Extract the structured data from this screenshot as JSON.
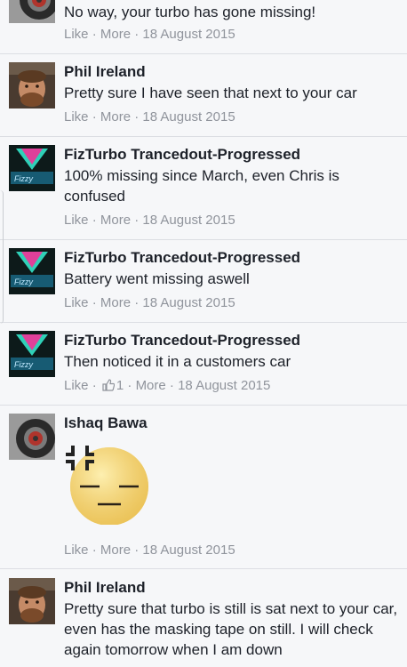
{
  "comments": [
    {
      "name": "",
      "text": "No way, your turbo has gone missing!",
      "like": "Like",
      "more": "More",
      "date": "18 August 2015"
    },
    {
      "name": "Phil Ireland",
      "text": "Pretty sure I have seen that next to your car",
      "like": "Like",
      "more": "More",
      "date": "18 August 2015"
    },
    {
      "name": "FizTurbo Trancedout-Progressed",
      "text": "100% missing since March, even Chris is confused",
      "like": "Like",
      "more": "More",
      "date": "18 August 2015"
    },
    {
      "name": "FizTurbo Trancedout-Progressed",
      "text": "Battery went missing aswell",
      "like": "Like",
      "more": "More",
      "date": "18 August 2015"
    },
    {
      "name": "FizTurbo Trancedout-Progressed",
      "text": "Then noticed it in a customers car",
      "like": "Like",
      "like_count": "1",
      "more": "More",
      "date": "18 August 2015"
    },
    {
      "name": "Ishaq Bawa",
      "sticker": "annoyed-face-sticker",
      "like": "Like",
      "more": "More",
      "date": "18 August 2015"
    },
    {
      "name": "Phil Ireland",
      "text": "Pretty sure that turbo is still is sat next to your car, even has the masking tape on still. I will check again tomorrow when I am down"
    }
  ],
  "separator": " · ",
  "colors": {
    "meta": "#90949c",
    "background": "#f6f7f9",
    "divider": "#dcdee3",
    "name": "#1d2129"
  }
}
